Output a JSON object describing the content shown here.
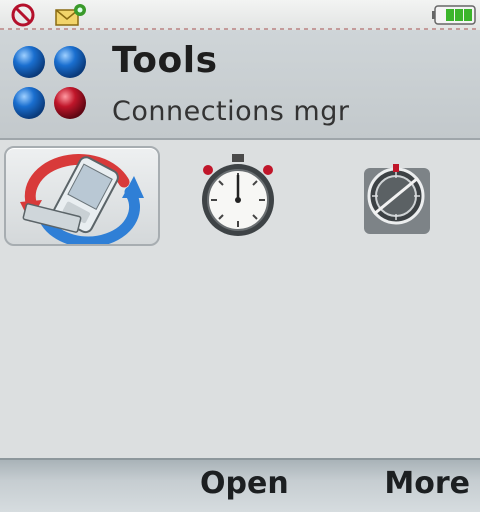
{
  "status_bar": {
    "icons": [
      "no-network-icon",
      "message-icon",
      "battery-icon"
    ]
  },
  "header": {
    "title": "Tools",
    "subtitle": "Connections mgr",
    "logo_icon": "tools-app-icon"
  },
  "grid": {
    "items": [
      {
        "icon": "connections-manager-icon",
        "selected": true
      },
      {
        "icon": "stopwatch-icon",
        "selected": false
      },
      {
        "icon": "settings-dial-icon",
        "selected": false
      }
    ]
  },
  "softkeys": {
    "center_label": "Open",
    "right_label": "More"
  },
  "colors": {
    "background": "#dcdfe0",
    "header": "#c9cfd2",
    "sync_red": "#d83a3a",
    "sync_blue": "#2f7fd6",
    "orb_blue": "#1a6fd0",
    "orb_red": "#c0162a"
  }
}
